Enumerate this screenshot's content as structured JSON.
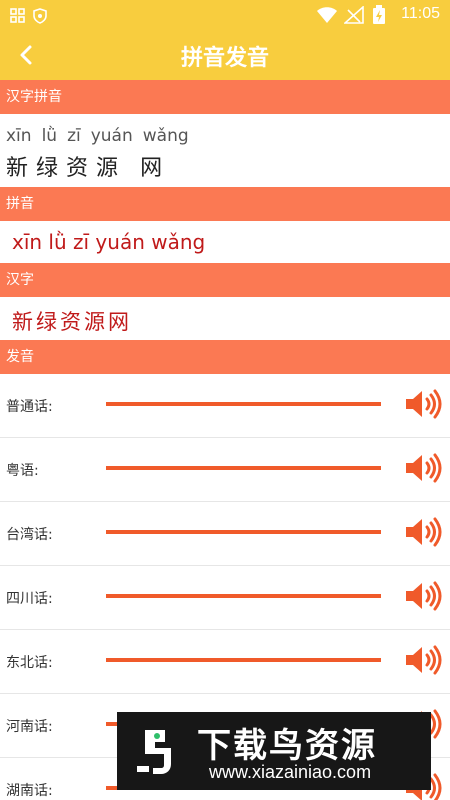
{
  "status": {
    "time": "11:05"
  },
  "header": {
    "title": "拼音发音"
  },
  "sections": {
    "hanzi_pinyin": "汉字拼音",
    "pinyin": "拼音",
    "hanzi": "汉字",
    "pronunciation": "发音"
  },
  "word": {
    "syllables": [
      "xīn",
      "lǜ",
      "zī",
      "yuán",
      "wǎng"
    ],
    "characters": [
      "新",
      "绿",
      "资",
      "源",
      "网"
    ],
    "pinyin_line": "xīn lǜ zī yuán wǎng",
    "hanzi_line": "新绿资源网"
  },
  "dialects": [
    {
      "label": "普通话:"
    },
    {
      "label": "粤语:"
    },
    {
      "label": "台湾话:"
    },
    {
      "label": "四川话:"
    },
    {
      "label": "东北话:"
    },
    {
      "label": "河南话:"
    },
    {
      "label": "湖南话:"
    }
  ],
  "colors": {
    "header": "#f8cd3e",
    "section": "#fb7953",
    "accent": "#f05a2a",
    "text_red": "#c01a1a"
  },
  "watermark": {
    "title": "下载鸟资源",
    "url": "www.xiazainiao.com"
  }
}
